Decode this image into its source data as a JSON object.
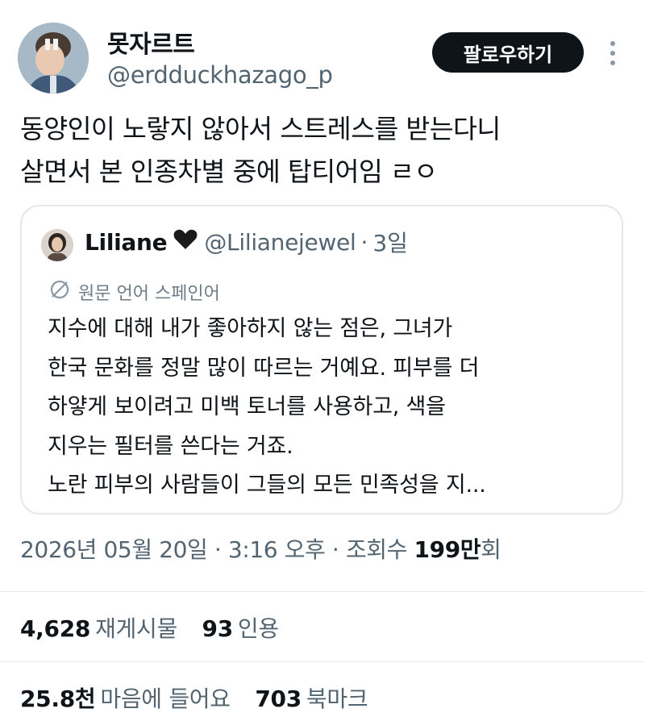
{
  "author": {
    "display_name": "못자르트",
    "handle": "@erdduckhazago_p",
    "follow_label": "팔로우하기"
  },
  "tweet": {
    "text": "동양인이 노랗지 않아서 스트레스를 받는다니\n살면서 본 인종차별 중에 탑티어임 ㄹㅇ"
  },
  "quote": {
    "name": "Liliane",
    "handle": "@Lilianejewel",
    "separator": "·",
    "time": "3일",
    "translate_label": "원문 언어 스페인어",
    "body": "지수에 대해 내가 좋아하지 않는 점은, 그녀가\n한국 문화를 정말 많이 따르는 거예요. 피부를 더\n하얗게 보이려고 미백 토너를 사용하고, 색을\n지우는 필터를 쓴다는 거죠.\n노란 피부의 사람들이 그들의 모든 민족성을 지..."
  },
  "meta": {
    "date": "2026년 05월 20일",
    "sep1": " · ",
    "time": "3:16 오후",
    "sep2": " · ",
    "views_label": "조회수 ",
    "views_count": "199만",
    "views_suffix": "회"
  },
  "stats": {
    "reposts_count": "4,628",
    "reposts_label": "재게시물",
    "quotes_count": "93",
    "quotes_label": "인용",
    "likes_count": "25.8천",
    "likes_label": "마음에 들어요",
    "bookmarks_count": "703",
    "bookmarks_label": "북마크"
  },
  "colors": {
    "text_primary": "#0f1419",
    "text_secondary": "#536471",
    "border": "#e3e8ec",
    "button_bg": "#0f1419"
  },
  "icons": {
    "more": "more-vertical-icon",
    "heart": "black-heart-icon",
    "translate": "translate-icon"
  }
}
